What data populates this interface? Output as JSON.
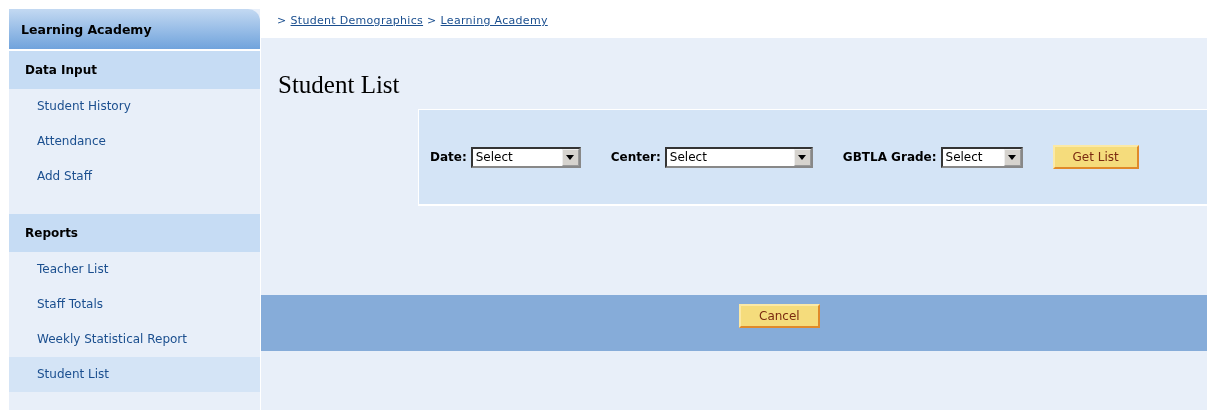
{
  "sidebar": {
    "title": "Learning Academy",
    "sections": [
      {
        "heading": "Data Input",
        "items": [
          {
            "label": "Student History",
            "selected": false
          },
          {
            "label": "Attendance",
            "selected": false
          },
          {
            "label": "Add Staff",
            "selected": false
          }
        ]
      },
      {
        "heading": "Reports",
        "items": [
          {
            "label": "Teacher List",
            "selected": false
          },
          {
            "label": "Staff Totals",
            "selected": false
          },
          {
            "label": "Weekly Statistical Report",
            "selected": false
          },
          {
            "label": "Student List",
            "selected": true
          }
        ]
      }
    ]
  },
  "breadcrumb": [
    {
      "separator": ">",
      "label": "Student Demographics"
    },
    {
      "separator": ">",
      "label": "Learning Academy"
    }
  ],
  "page_title": "Student List",
  "filters": [
    {
      "label": "Date:",
      "value": "Select"
    },
    {
      "label": "Center:",
      "value": "Select"
    },
    {
      "label": "GBTLA Grade:",
      "value": "Select"
    }
  ],
  "get_list_button": "Get List",
  "cancel_button": "Cancel"
}
